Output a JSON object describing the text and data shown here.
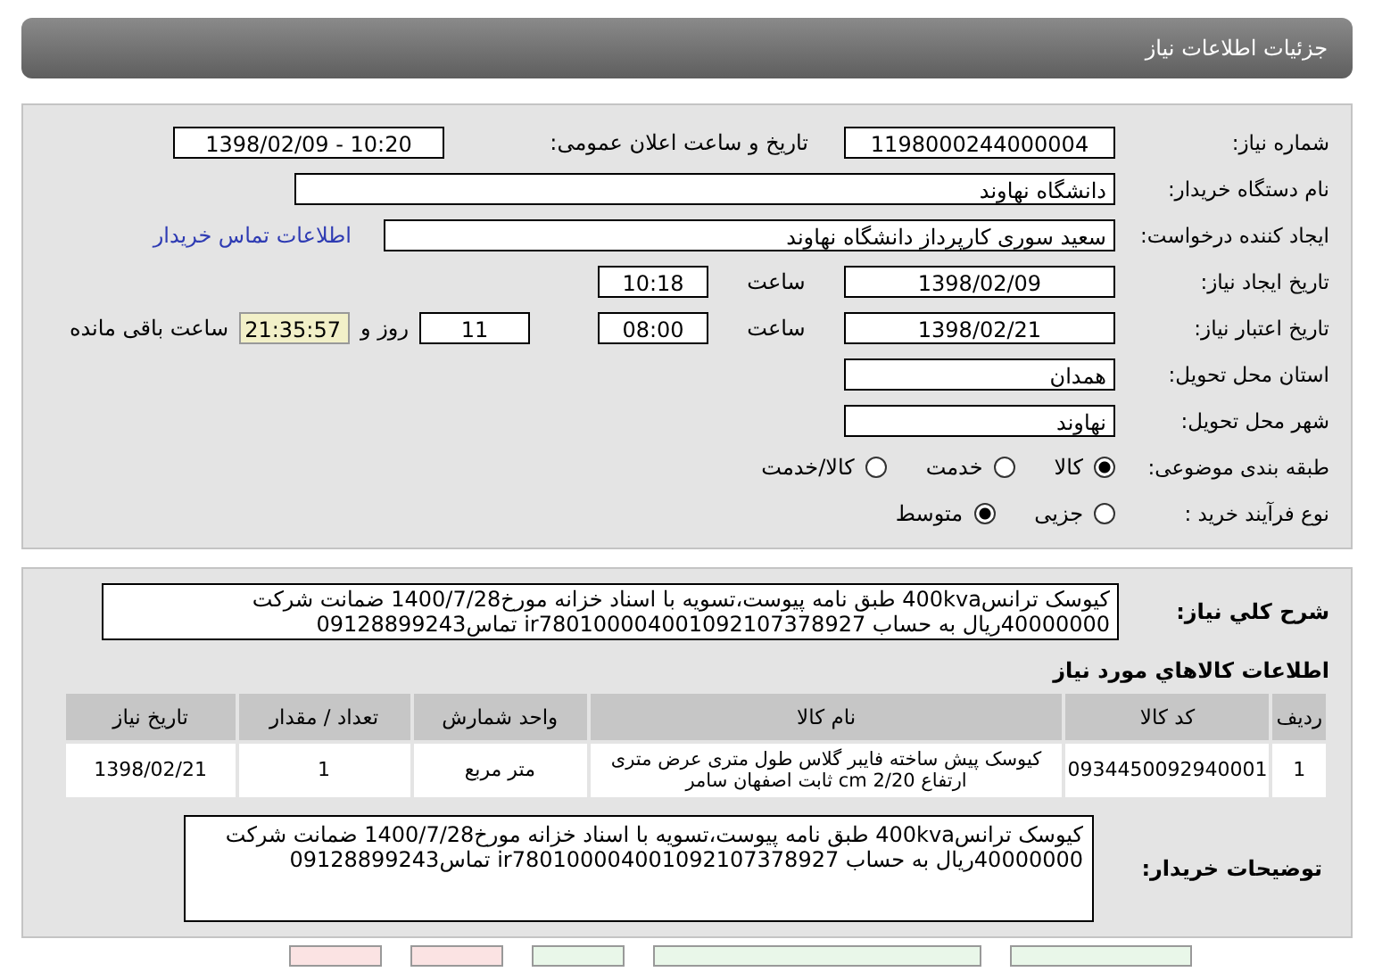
{
  "header": {
    "title": "جزئیات اطلاعات نیاز"
  },
  "need_number": {
    "label": "شماره نیاز:",
    "value": "1198000244000004"
  },
  "announce": {
    "label": "تاریخ و ساعت اعلان عمومی:",
    "value": "1398/02/09 - 10:20"
  },
  "buyer_org": {
    "label": "نام دستگاه خریدار:",
    "value": "دانشگاه نهاوند"
  },
  "requester": {
    "label": "ایجاد کننده درخواست:",
    "value": "سعید سوری کارپرداز دانشگاه نهاوند",
    "link": "اطلاعات تماس خریدار"
  },
  "created": {
    "label": "تاریخ ایجاد نیاز:",
    "date": "1398/02/09",
    "time_label": "ساعت",
    "time": "10:18"
  },
  "validity": {
    "label": "تاریخ اعتبار نیاز:",
    "date": "1398/02/21",
    "time_label": "ساعت",
    "time": "08:00",
    "days": "11",
    "days_label": "روز و",
    "remaining": "21:35:57",
    "remaining_label": "ساعت باقی مانده"
  },
  "province": {
    "label": "استان محل تحویل:",
    "value": "همدان"
  },
  "city": {
    "label": "شهر محل تحویل:",
    "value": "نهاوند"
  },
  "category": {
    "label": "طبقه بندی موضوعی:",
    "options": [
      {
        "label": "کالا",
        "selected": true
      },
      {
        "label": "خدمت",
        "selected": false
      },
      {
        "label": "کالا/خدمت",
        "selected": false
      }
    ]
  },
  "process": {
    "label": "نوع فرآیند خرید :",
    "options": [
      {
        "label": "جزیی",
        "selected": false
      },
      {
        "label": "متوسط",
        "selected": true
      }
    ]
  },
  "description": {
    "label": "شرح کلي نیاز:",
    "text": "کیوسک ترانس400kva طبق نامه پیوست،تسویه با اسناد خزانه مورخ1400/7/28 ضمانت شرکت 40000000ریال به حساب ir780100004001092107378927 تماس09128899243"
  },
  "items": {
    "title": "اطلاعات کالاهاي مورد نياز",
    "columns": [
      "ردیف",
      "کد کالا",
      "نام کالا",
      "واحد شمارش",
      "تعداد / مقدار",
      "تاریخ نیاز"
    ],
    "rows": [
      [
        "1",
        "0934450092940001",
        "کیوسک پیش ساخته فایبر گلاس طول متری عرض متری ارتفاع cm 2/20 ثابت اصفهان سامر",
        "متر مربع",
        "1",
        "1398/02/21"
      ]
    ]
  },
  "buyer_notes": {
    "label": "توضیحات خریدار:",
    "text": "کیوسک ترانس400kva طبق نامه پیوست،تسویه با اسناد خزانه مورخ1400/7/28 ضمانت شرکت 40000000ریال به حساب ir780100004001092107378927 تماس09128899243"
  }
}
